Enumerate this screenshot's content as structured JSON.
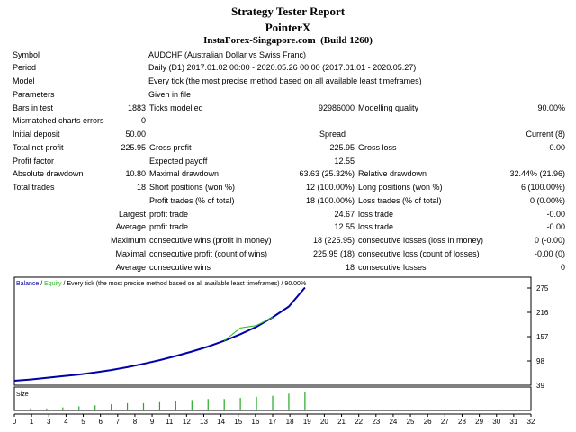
{
  "header": {
    "title": "Strategy Tester Report",
    "expert": "PointerX",
    "broker": "InstaForex-Singapore.com",
    "build": "(Build 1260)"
  },
  "report": {
    "symbol_label": "Symbol",
    "symbol": "AUDCHF (Australian Dollar vs Swiss Franc)",
    "period_label": "Period",
    "period": "Daily (D1) 2017.01.02 00:00 - 2020.05.26 00:00 (2017.01.01 - 2020.05.27)",
    "model_label": "Model",
    "model": "Every tick (the most precise method based on all available least timeframes)",
    "parameters_label": "Parameters",
    "parameters": "Given in file",
    "bars_label": "Bars in test",
    "bars": "1883",
    "ticks_label": "Ticks modelled",
    "ticks": "92986000",
    "quality_label": "Modelling quality",
    "quality": "90.00%",
    "mismatched_label": "Mismatched charts errors",
    "mismatched": "0",
    "initial_deposit_label": "Initial deposit",
    "initial_deposit": "50.00",
    "spread_label": "Spread",
    "spread": "Current (8)",
    "net_profit_label": "Total net profit",
    "net_profit": "225.95",
    "gross_profit_label": "Gross profit",
    "gross_profit": "225.95",
    "gross_loss_label": "Gross loss",
    "gross_loss": "-0.00",
    "profit_factor_label": "Profit factor",
    "expected_payoff_label": "Expected payoff",
    "expected_payoff": "12.55",
    "abs_dd_label": "Absolute drawdown",
    "abs_dd": "10.80",
    "max_dd_label": "Maximal drawdown",
    "max_dd": "63.63 (25.32%)",
    "rel_dd_label": "Relative drawdown",
    "rel_dd": "32.44% (21.96)",
    "total_trades_label": "Total trades",
    "total_trades": "18",
    "short_label": "Short positions (won %)",
    "short": "12 (100.00%)",
    "long_label": "Long positions (won %)",
    "long": "6 (100.00%)",
    "profit_trades_label": "Profit trades (% of total)",
    "profit_trades": "18 (100.00%)",
    "loss_trades_label": "Loss trades (% of total)",
    "loss_trades": "0 (0.00%)",
    "largest_label": "Largest",
    "largest_profit_label": "profit trade",
    "largest_profit": "24.67",
    "largest_loss_label": "loss trade",
    "largest_loss": "-0.00",
    "average_label": "Average",
    "average_profit_label": "profit trade",
    "average_profit": "12.55",
    "average_loss_label": "loss trade",
    "average_loss": "-0.00",
    "max_cw_label": "Maximum",
    "max_cw_desc": "consecutive wins (profit in money)",
    "max_cw": "18 (225.95)",
    "max_cl_desc": "consecutive losses (loss in money)",
    "max_cl": "0 (-0.00)",
    "maximal_label": "Maximal",
    "maximal_cp_desc": "consecutive profit (count of wins)",
    "maximal_cp": "225.95 (18)",
    "maximal_cl_desc": "consecutive loss (count of losses)",
    "maximal_cl": "-0.00 (0)",
    "avg_cons_label": "Average",
    "avg_cw_desc": "consecutive wins",
    "avg_cw": "18",
    "avg_cl_desc": "consecutive losses",
    "avg_cl": "0"
  },
  "chart_data": {
    "type": "line",
    "legend_balance": "Balance",
    "legend_sep": "/",
    "legend_equity": "Equity",
    "legend_rest": "/ Every tick (the most precise method based on all available least timeframes) / 90.00%",
    "y_ticks": [
      "275",
      "216",
      "157",
      "98",
      "39"
    ],
    "ylim": [
      39,
      275
    ],
    "x_ticks": [
      "0",
      "1",
      "3",
      "4",
      "5",
      "6",
      "7",
      "8",
      "9",
      "11",
      "12",
      "13",
      "14",
      "15",
      "16",
      "17",
      "18",
      "19",
      "20",
      "21",
      "22",
      "23",
      "24",
      "25",
      "26",
      "27",
      "28",
      "29",
      "30",
      "31",
      "32"
    ],
    "xlim": [
      0,
      32
    ],
    "size_label": "Size",
    "colors": {
      "balance": "#0000aa",
      "equity": "#22bb22",
      "size": "#22aa22",
      "axis": "#000000"
    },
    "series": [
      {
        "name": "Balance",
        "x": [
          0,
          1,
          2,
          3,
          4,
          5,
          6,
          7,
          8,
          9,
          10,
          11,
          12,
          13,
          14,
          15,
          16,
          17,
          18
        ],
        "values": [
          50,
          53,
          57,
          61,
          65,
          70,
          76,
          83,
          91,
          100,
          110,
          121,
          133,
          147,
          163,
          181,
          204,
          230,
          276
        ]
      },
      {
        "name": "Equity",
        "x": [
          13,
          14,
          15,
          16
        ],
        "values": [
          147,
          178,
          184,
          204
        ]
      }
    ],
    "sizes": [
      1,
      1,
      2,
      3,
      4,
      5,
      6,
      6,
      7,
      8,
      9,
      10,
      10,
      11,
      12,
      13,
      15,
      17
    ]
  }
}
